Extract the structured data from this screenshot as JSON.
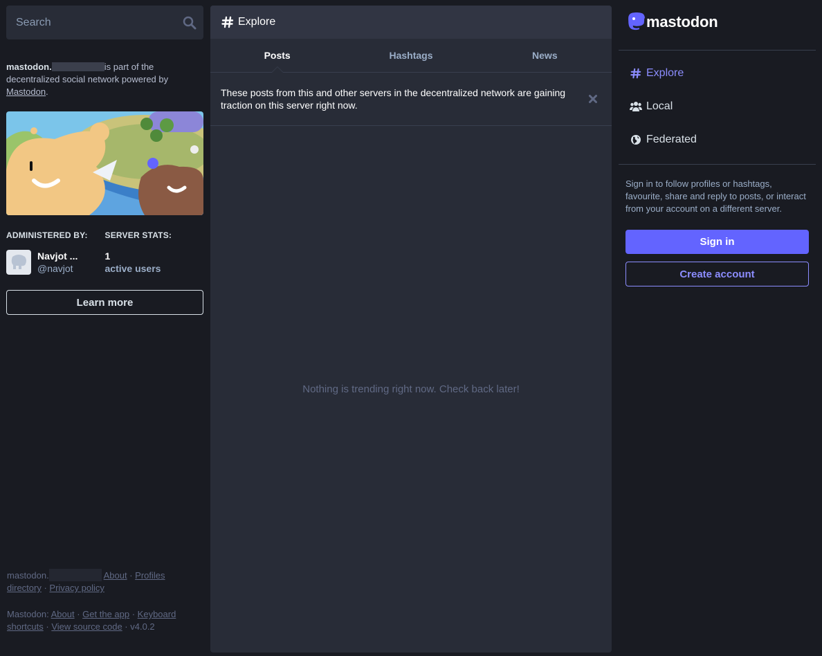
{
  "colors": {
    "background": "#191b22",
    "panel": "#282c37",
    "accent": "#6364ff",
    "accent_text": "#8c8dff",
    "muted": "#606984"
  },
  "search": {
    "placeholder": "Search",
    "icon": "search-icon"
  },
  "server_info": {
    "domain": "mastodon.",
    "text": "is part of the decentralized social network powered by",
    "link": "Mastodon",
    "period": "."
  },
  "admin": {
    "heading": "ADMINISTERED BY:",
    "name": "Navjot ...",
    "handle": "@navjot"
  },
  "stats": {
    "heading": "SERVER STATS:",
    "count": "1",
    "label": "active users"
  },
  "learn_more": "Learn more",
  "footer": {
    "domain": "mastodon.",
    "server_links": [
      "About",
      "Profiles directory",
      "Privacy policy"
    ],
    "prefix": "Mastodon:",
    "mastodon_links": [
      "About",
      "Get the app",
      "Keyboard shortcuts",
      "View source code"
    ],
    "version": "v4.0.2",
    "separator": " · "
  },
  "explore": {
    "title": "Explore",
    "tabs": [
      {
        "label": "Posts",
        "active": true
      },
      {
        "label": "Hashtags",
        "active": false
      },
      {
        "label": "News",
        "active": false
      }
    ],
    "banner": "These posts from this and other servers in the decentralized network are gaining traction on this server right now.",
    "empty": "Nothing is trending right now. Check back later!"
  },
  "right": {
    "logo_text": "mastodon",
    "nav": [
      {
        "label": "Explore",
        "icon": "hashtag-icon",
        "active": true
      },
      {
        "label": "Local",
        "icon": "users-icon",
        "active": false
      },
      {
        "label": "Federated",
        "icon": "globe-icon",
        "active": false
      }
    ],
    "signin_prompt": "Sign in to follow profiles or hashtags, favourite, share and reply to posts, or interact from your account on a different server.",
    "signin_button": "Sign in",
    "create_button": "Create account"
  }
}
